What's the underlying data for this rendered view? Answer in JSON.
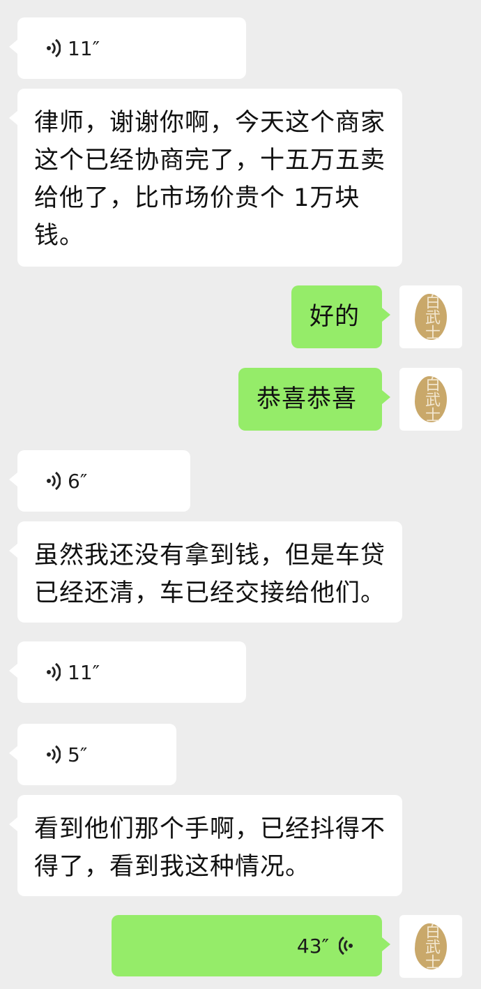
{
  "messages": [
    {
      "type": "voice",
      "side": "left",
      "duration": "11″"
    },
    {
      "type": "text",
      "side": "left",
      "text": "律师，谢谢你啊，今天这个商家这个已经协商完了，十五万五卖给他了，比市场价贵个 1万块钱。"
    },
    {
      "type": "text",
      "side": "right",
      "text": "好的"
    },
    {
      "type": "text",
      "side": "right",
      "text": "恭喜恭喜"
    },
    {
      "type": "voice",
      "side": "left",
      "duration": "6″"
    },
    {
      "type": "text",
      "side": "left",
      "text": "虽然我还没有拿到钱，但是车贷已经还清，车已经交接给他们。"
    },
    {
      "type": "voice",
      "side": "left",
      "duration": "11″"
    },
    {
      "type": "voice",
      "side": "left",
      "duration": "5″"
    },
    {
      "type": "text",
      "side": "left",
      "text": "看到他们那个手啊，已经抖得不得了，看到我这种情况。"
    },
    {
      "type": "voice",
      "side": "right",
      "duration": "43″"
    }
  ],
  "avatar": {
    "seal_text": "白武士"
  },
  "colors": {
    "background": "#ededed",
    "left_bubble": "#ffffff",
    "right_bubble": "#95ec69"
  }
}
